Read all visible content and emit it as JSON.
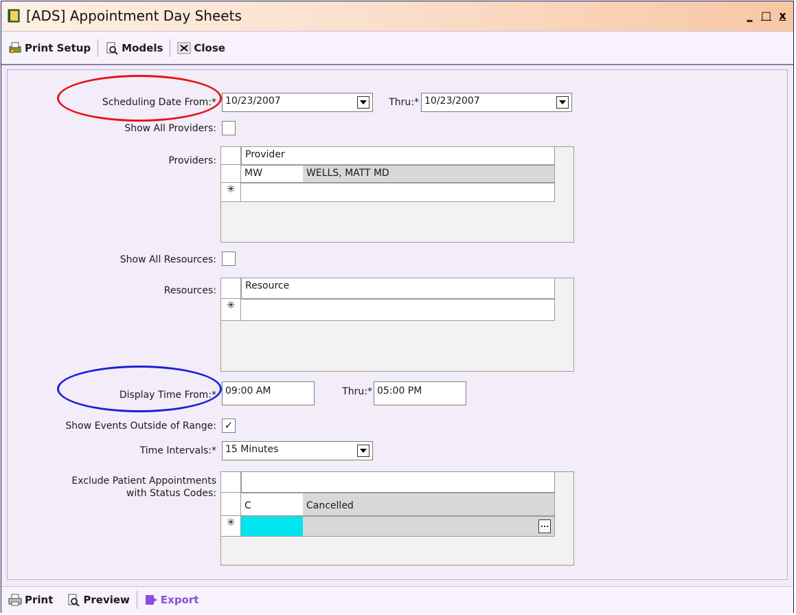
{
  "window": {
    "title": "[ADS] Appointment Day Sheets",
    "minimize": "_",
    "maximize": "□",
    "close": "x"
  },
  "toolbar": {
    "print_setup": "Print Setup",
    "models": "Models",
    "close": "Close"
  },
  "form": {
    "scheduling_date_label": "Scheduling Date From:*",
    "scheduling_date_from": "10/23/2007",
    "thru_label": "Thru:*",
    "scheduling_date_thru": "10/23/2007",
    "show_all_providers_label": "Show All Providers:",
    "providers_label": "Providers:",
    "providers_header": "Provider",
    "providers_rows": [
      {
        "code": "MW",
        "name": "WELLS, MATT MD"
      }
    ],
    "new_row_marker": "✳",
    "show_all_resources_label": "Show All Resources:",
    "resources_label": "Resources:",
    "resources_header": "Resource",
    "display_time_label": "Display Time From:*",
    "display_time_from": "09:00 AM",
    "display_thru_label": "Thru:*",
    "display_time_thru": "05:00 PM",
    "show_events_label": "Show Events Outside of Range:",
    "show_events_checked": "✓",
    "time_intervals_label": "Time Intervals:*",
    "time_intervals_value": "15 Minutes",
    "exclude_label_line1": "Exclude Patient Appointments",
    "exclude_label_line2": "with Status Codes:",
    "status_rows": [
      {
        "code": "C",
        "name": "Cancelled"
      }
    ],
    "ellipsis": "..."
  },
  "bottombar": {
    "print": "Print",
    "preview": "Preview",
    "export": "Export"
  },
  "colors": {
    "annotation_red": "#e8121a",
    "annotation_blue": "#1c1fd6",
    "highlight_cyan": "#00e5ee",
    "export_purple": "#8a4fd8"
  }
}
